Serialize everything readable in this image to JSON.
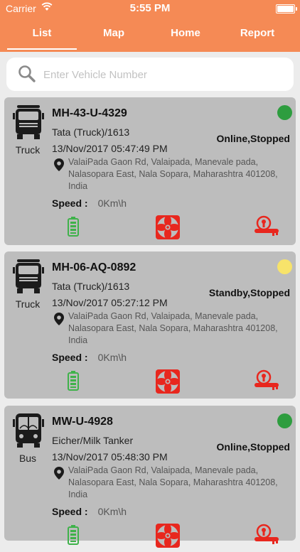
{
  "status_bar": {
    "carrier": "Carrier",
    "time": "5:55 PM"
  },
  "tabs": [
    {
      "label": "List"
    },
    {
      "label": "Map"
    },
    {
      "label": "Home"
    },
    {
      "label": "Report"
    }
  ],
  "search": {
    "placeholder": "Enter Vehicle Number",
    "value": ""
  },
  "colors": {
    "accent": "#f58a55",
    "online": "#2e9d3f",
    "standby": "#f7e36a",
    "icon_red": "#e8271e",
    "battery_green": "#3fb24a"
  },
  "vehicles": [
    {
      "type": "Truck",
      "plate": "MH-43-U-4329",
      "model": "Tata (Truck)/1613",
      "timestamp": "13/Nov/2017 05:47:49 PM",
      "address": "ValaiPada Gaon Rd, Valaipada, Manevale pada, Nalasopara East, Nala Sopara, Maharashtra 401208, India",
      "status": "Online,Stopped",
      "status_color": "#2e9d3f",
      "speed_label": "Speed :",
      "speed_value": "0Km\\h",
      "icon": "truck-icon"
    },
    {
      "type": "Truck",
      "plate": "MH-06-AQ-0892",
      "model": "Tata (Truck)/1613",
      "timestamp": "13/Nov/2017 05:27:12 PM",
      "address": "ValaiPada Gaon Rd, Valaipada, Manevale pada, Nalasopara East, Nala Sopara, Maharashtra 401208, India",
      "status": "Standby,Stopped",
      "status_color": "#f7e36a",
      "speed_label": "Speed :",
      "speed_value": "0Km\\h",
      "icon": "truck-icon"
    },
    {
      "type": "Bus",
      "plate": "MW-U-4928",
      "model": "Eicher/Milk Tanker",
      "timestamp": "13/Nov/2017 05:48:30 PM",
      "address": "ValaiPada Gaon Rd, Valaipada, Manevale pada, Nalasopara East, Nala Sopara, Maharashtra 401208, India",
      "status": "Online,Stopped",
      "status_color": "#2e9d3f",
      "speed_label": "Speed :",
      "speed_value": "0Km\\h",
      "icon": "bus-icon"
    }
  ]
}
